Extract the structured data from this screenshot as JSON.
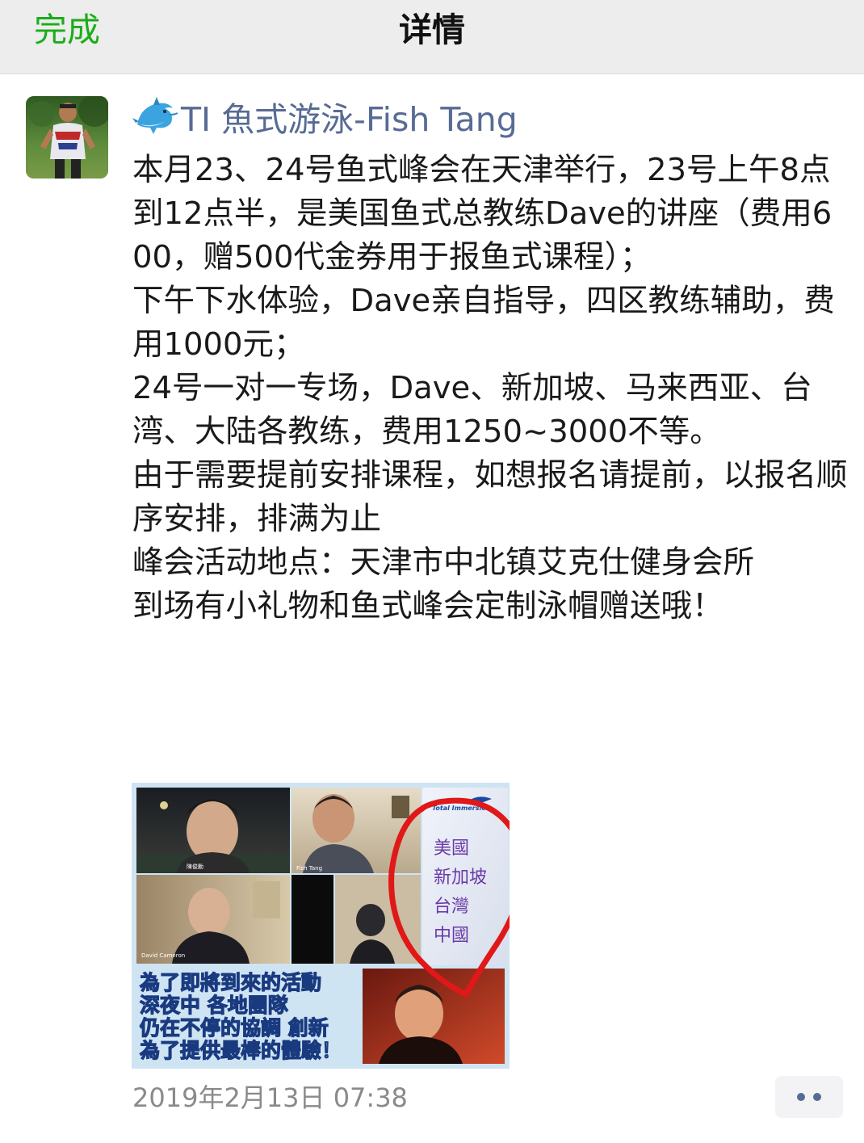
{
  "nav": {
    "done_label": "完成",
    "title": "详情"
  },
  "post": {
    "author": "TI 魚式游泳-Fish Tang",
    "author_icon": "dolphin-icon",
    "paragraphs": [
      "本月23、24号鱼式峰会在天津举行，23号上午8点到12点半，是美国鱼式总教练Dave的讲座（费用600，赠500代金券用于报鱼式课程）；",
      "下午下水体验，Dave亲自指导，四区教练辅助，费用1000元；",
      "24号一对一专场，Dave、新加坡、马来西亚、台湾、大陆各教练，费用1250~3000不等。",
      "由于需要提前安排课程，如想报名请提前，以报名顺序安排，排满为止",
      "峰会活动地点：天津市中北镇艾克仕健身会所",
      "到场有小礼物和鱼式峰会定制泳帽赠送哦！"
    ],
    "timestamp": "2019年2月13日 07:38"
  },
  "image": {
    "names": [
      "陳俊勳",
      "Fish Tang",
      "David Cameron"
    ],
    "logo_text": "Total Immersion",
    "side_list": [
      "美國",
      "新加坡",
      "台灣",
      "中國"
    ],
    "caption_lines": [
      "為了即將到來的活動",
      "深夜中 各地團隊",
      "仍在不停的協調 創新",
      "為了提供最棒的體驗！"
    ]
  },
  "colors": {
    "accent_green": "#1aad19",
    "link_blue": "#576b95",
    "nav_bg": "#ededed",
    "timestamp_gray": "#8a8a8a",
    "circle_red": "#e01818",
    "caption_cyan": "#4fd0f0"
  }
}
